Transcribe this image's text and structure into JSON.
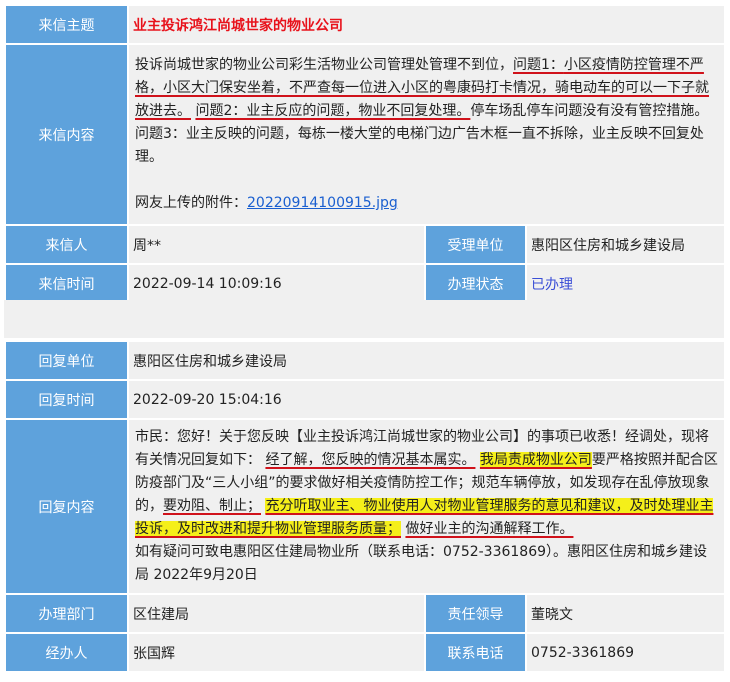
{
  "letter": {
    "subject_label": "来信主题",
    "subject": "业主投诉鸿江尚城世家的物业公司",
    "content_label": "来信内容",
    "content": {
      "intro": "投诉尚城世家的物业公司彩生活物业公司管理处管理不到位，",
      "q1_prefix": "问题1：",
      "q1_text": "小区疫情防控管理不严格，小区大门保安坐着，不严查每一位进入小区的粤康码打卡情况，骑电动车的可以一下子就放进去。",
      "q2_text": "问题2：业主反应的问题，物业不回复处理。",
      "rest": "停车场乱停车问题没有没有管控措施。问题3：业主反映的问题，每栋一楼大堂的电梯门边广告木框一直不拆除，业主反映不回复处理。",
      "attachment_label": "网友上传的附件：",
      "attachment_file": "20220914100915.jpg"
    },
    "sender_label": "来信人",
    "sender": "周**",
    "accept_label": "受理单位",
    "accept_unit": "惠阳区住房和城乡建设局",
    "time_label": "来信时间",
    "time": "2022-09-14 10:09:16",
    "status_label": "办理状态",
    "status": "已办理"
  },
  "reply": {
    "unit_label": "回复单位",
    "unit": "惠阳区住房和城乡建设局",
    "time_label": "回复时间",
    "time": "2022-09-20 15:04:16",
    "content_label": "回复内容",
    "content": {
      "p1": "市民：您好！关于您反映【业主投诉鸿江尚城世家的物业公司】的事项已收悉！经调处，现将有关情况回复如下：",
      "p2": "经了解，您反映的情况基本属实。",
      "p3": "我局责成物业公司",
      "p4": "要严格按照并配合区防疫部门及“三人小组”的要求做好相关疫情防控工作；规范车辆停放，如发现存在乱停放现象的，",
      "p5": "要劝阻、制止；",
      "p6": "充分听取业主、物业使用人对物业管理服务的意见和建议，及时处理业主投诉，及时改进和提升物业管理服务质量；",
      "p7": "做好业主的沟通解释工作。",
      "p8": "如有疑问可致电惠阳区住建局物业所（联系电话：0752-3361869）。惠阳区住房和城乡建设局 2022年9月20日"
    },
    "dept_label": "办理部门",
    "dept": "区住建局",
    "leader_label": "责任领导",
    "leader": "董晓文",
    "handler_label": "经办人",
    "handler": "张国辉",
    "phone_label": "联系电话",
    "phone": "0752-3361869"
  }
}
